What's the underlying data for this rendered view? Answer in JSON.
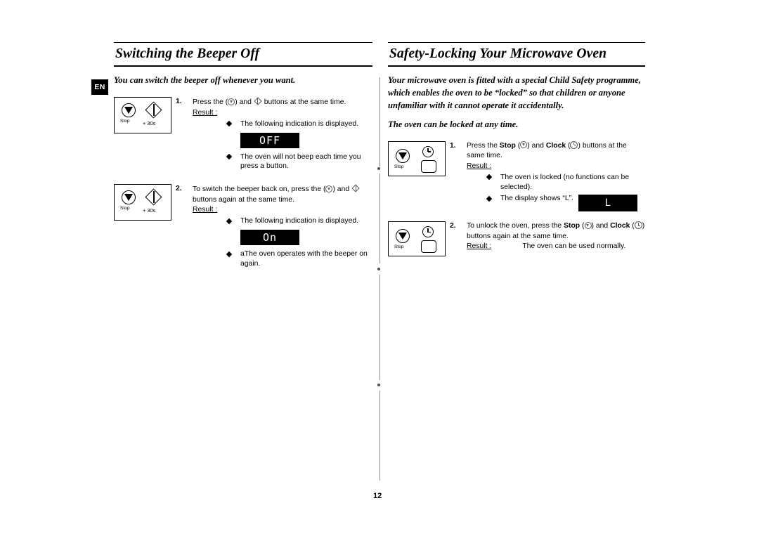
{
  "document": {
    "language_tab": "EN",
    "page_number": "12"
  },
  "left_section": {
    "title": "Switching the Beeper Off",
    "intro": "You can switch the beeper off whenever you want.",
    "steps": [
      {
        "number": "1.",
        "text_before_icon1": "Press the (",
        "text_between_icons": ") and",
        "text_after_icon2": "buttons at the same time.",
        "result_label": "Result :",
        "panel": {
          "stop_label": "Stop",
          "plus30s_label": "+ 30s"
        },
        "bullets": [
          {
            "text": "The following indication is displayed.",
            "display": null
          },
          {
            "text": "The oven will not beep each time you press a button.",
            "display": null
          }
        ],
        "display_value": "OFF"
      },
      {
        "number": "2.",
        "text_before_icon1": "To switch the beeper back on, press the (",
        "text_between_icons": ") and",
        "text_after_icon2": "buttons again at the same time.",
        "result_label": "Result :",
        "panel": {
          "stop_label": "Stop",
          "plus30s_label": "+ 30s"
        },
        "bullets": [
          {
            "text": "The following indication is displayed.",
            "display": null
          },
          {
            "text": "aThe oven operates with the beeper on again.",
            "display": null
          }
        ],
        "display_value": "On"
      }
    ]
  },
  "right_section": {
    "title": "Safety-Locking Your Microwave Oven",
    "intro_paragraph": "Your microwave oven is fitted with a special Child Safety programme, which enables the oven to be “locked” so that children or anyone unfamiliar with it cannot operate it accidentally.",
    "intro_second": "The oven can be locked at any time.",
    "steps": [
      {
        "number": "1.",
        "text_part1": "Press the",
        "bold1": "Stop",
        "text_part2": "(",
        "text_part3": ") and",
        "bold2": "Clock",
        "text_part4": "(",
        "text_part5": ") buttons at the same time.",
        "result_label": "Result :",
        "panel": {
          "stop_label": "Stop"
        },
        "bullets": [
          {
            "text": "The oven is locked (no functions can be selected)."
          },
          {
            "text": "The display shows “L”."
          }
        ],
        "display_value": "L"
      },
      {
        "number": "2.",
        "text_part1": "To unlock the oven, press the",
        "bold1": "Stop",
        "text_part2": "(",
        "text_part3": ") and",
        "bold2": "Clock",
        "text_part4": "(",
        "text_part5": ") buttons again at the same time.",
        "result_label": "Result :",
        "result_text": "The oven can be used normally.",
        "panel": {
          "stop_label": "Stop"
        }
      }
    ]
  },
  "colors": {
    "ink": "#000000",
    "divider": "#8a8a8a",
    "led_background": "#000000",
    "led_text": "#ffffff"
  },
  "icons": {
    "stop": "stop-button-icon",
    "plus30s": "plus-30-seconds-button-icon",
    "clock": "clock-button-icon",
    "bullet": "diamond-bullet-icon"
  }
}
